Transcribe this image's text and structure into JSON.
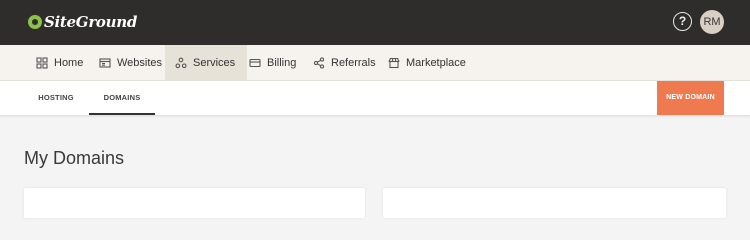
{
  "header": {
    "brand": "SiteGround",
    "help_glyph": "?",
    "avatar_initials": "RM"
  },
  "nav": {
    "items": [
      {
        "label": "Home",
        "icon": "grid-icon"
      },
      {
        "label": "Websites",
        "icon": "websites-icon"
      },
      {
        "label": "Services",
        "icon": "services-icon",
        "active": true
      },
      {
        "label": "Billing",
        "icon": "card-icon"
      },
      {
        "label": "Referrals",
        "icon": "share-icon"
      },
      {
        "label": "Marketplace",
        "icon": "store-icon"
      }
    ]
  },
  "subnav": {
    "tabs": [
      {
        "label": "HOSTING"
      },
      {
        "label": "DOMAINS",
        "active": true
      }
    ],
    "new_domain_label": "NEW DOMAIN"
  },
  "main": {
    "title": "My Domains"
  },
  "colors": {
    "topbar": "#2f2d2c",
    "accent": "#f07a4f",
    "logo_green": "#8bc34a",
    "nav_bg": "#f6f3ee"
  }
}
